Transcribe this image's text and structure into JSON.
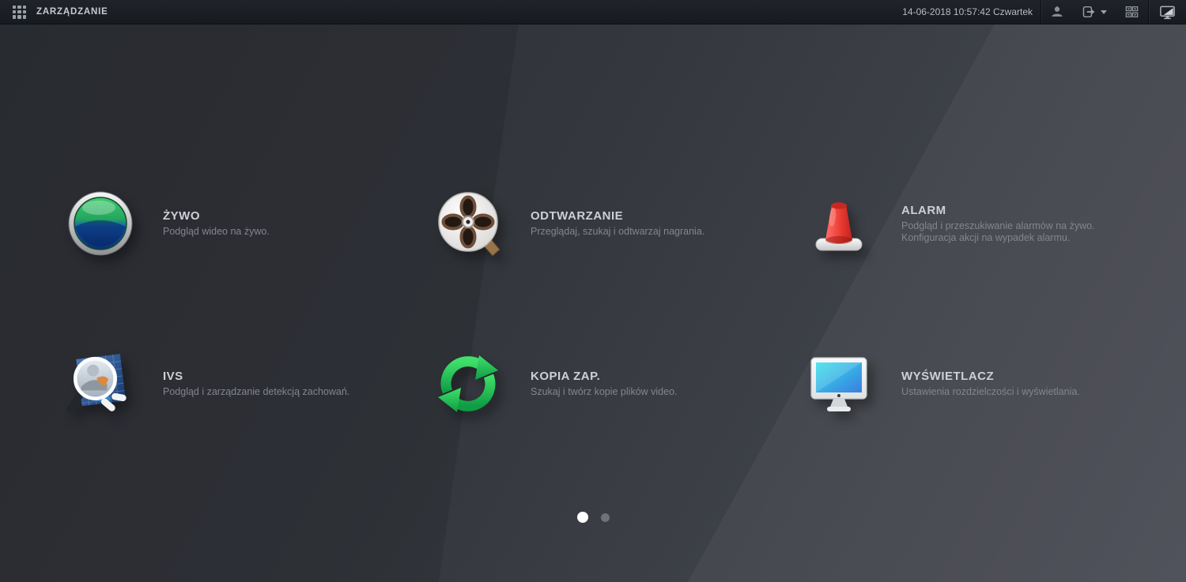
{
  "header": {
    "title": "ZARZĄDZANIE",
    "datetime": "14-06-2018 10:57:42 Czwartek",
    "icons": {
      "apps_grid": "apps-grid-icon",
      "user": "user-icon",
      "logout": "logout-icon",
      "caret": "caret-down-icon",
      "layout": "screen-layout-icon",
      "monitor": "display-output-icon"
    }
  },
  "menu": {
    "items": [
      {
        "id": "live",
        "icon": "live-lens-icon",
        "title": "ŻYWO",
        "desc": [
          "Podgląd wideo na żywo."
        ]
      },
      {
        "id": "playback",
        "icon": "playback-reel-icon",
        "title": "ODTWARZANIE",
        "desc": [
          "Przeglądaj, szukaj i odtwarzaj nagrania."
        ]
      },
      {
        "id": "alarm",
        "icon": "alarm-siren-icon",
        "title": "ALARM",
        "desc": [
          "Podgląd i przeszukiwanie alarmów na żywo.",
          "Konfiguracja akcji na wypadek alarmu."
        ]
      },
      {
        "id": "ivs",
        "icon": "ivs-magnifier-icon",
        "title": "IVS",
        "desc": [
          "Podgląd i zarządzanie detekcją zachowań."
        ]
      },
      {
        "id": "backup",
        "icon": "backup-sync-icon",
        "title": "KOPIA ZAP.",
        "desc": [
          "Szukaj i twórz kopie plików video."
        ]
      },
      {
        "id": "display",
        "icon": "display-monitor-icon",
        "title": "WYŚWIETLACZ",
        "desc": [
          "Ustawienia rozdzielczości i wyświetlania."
        ]
      }
    ]
  },
  "pagination": {
    "pages": 2,
    "active_index": 0
  },
  "colors": {
    "topbar_bg": "#1b1e23",
    "bg_dark": "#2d3036",
    "bg_light": "#4a4c55",
    "title_text": "#cdd0d4",
    "desc_text": "#83868d",
    "accent_green": "#2fc95f",
    "alarm_red": "#e8423a",
    "screen_cyan": "#35d5ea",
    "dot_active": "#ffffff",
    "dot_inactive": "#6f7278"
  }
}
